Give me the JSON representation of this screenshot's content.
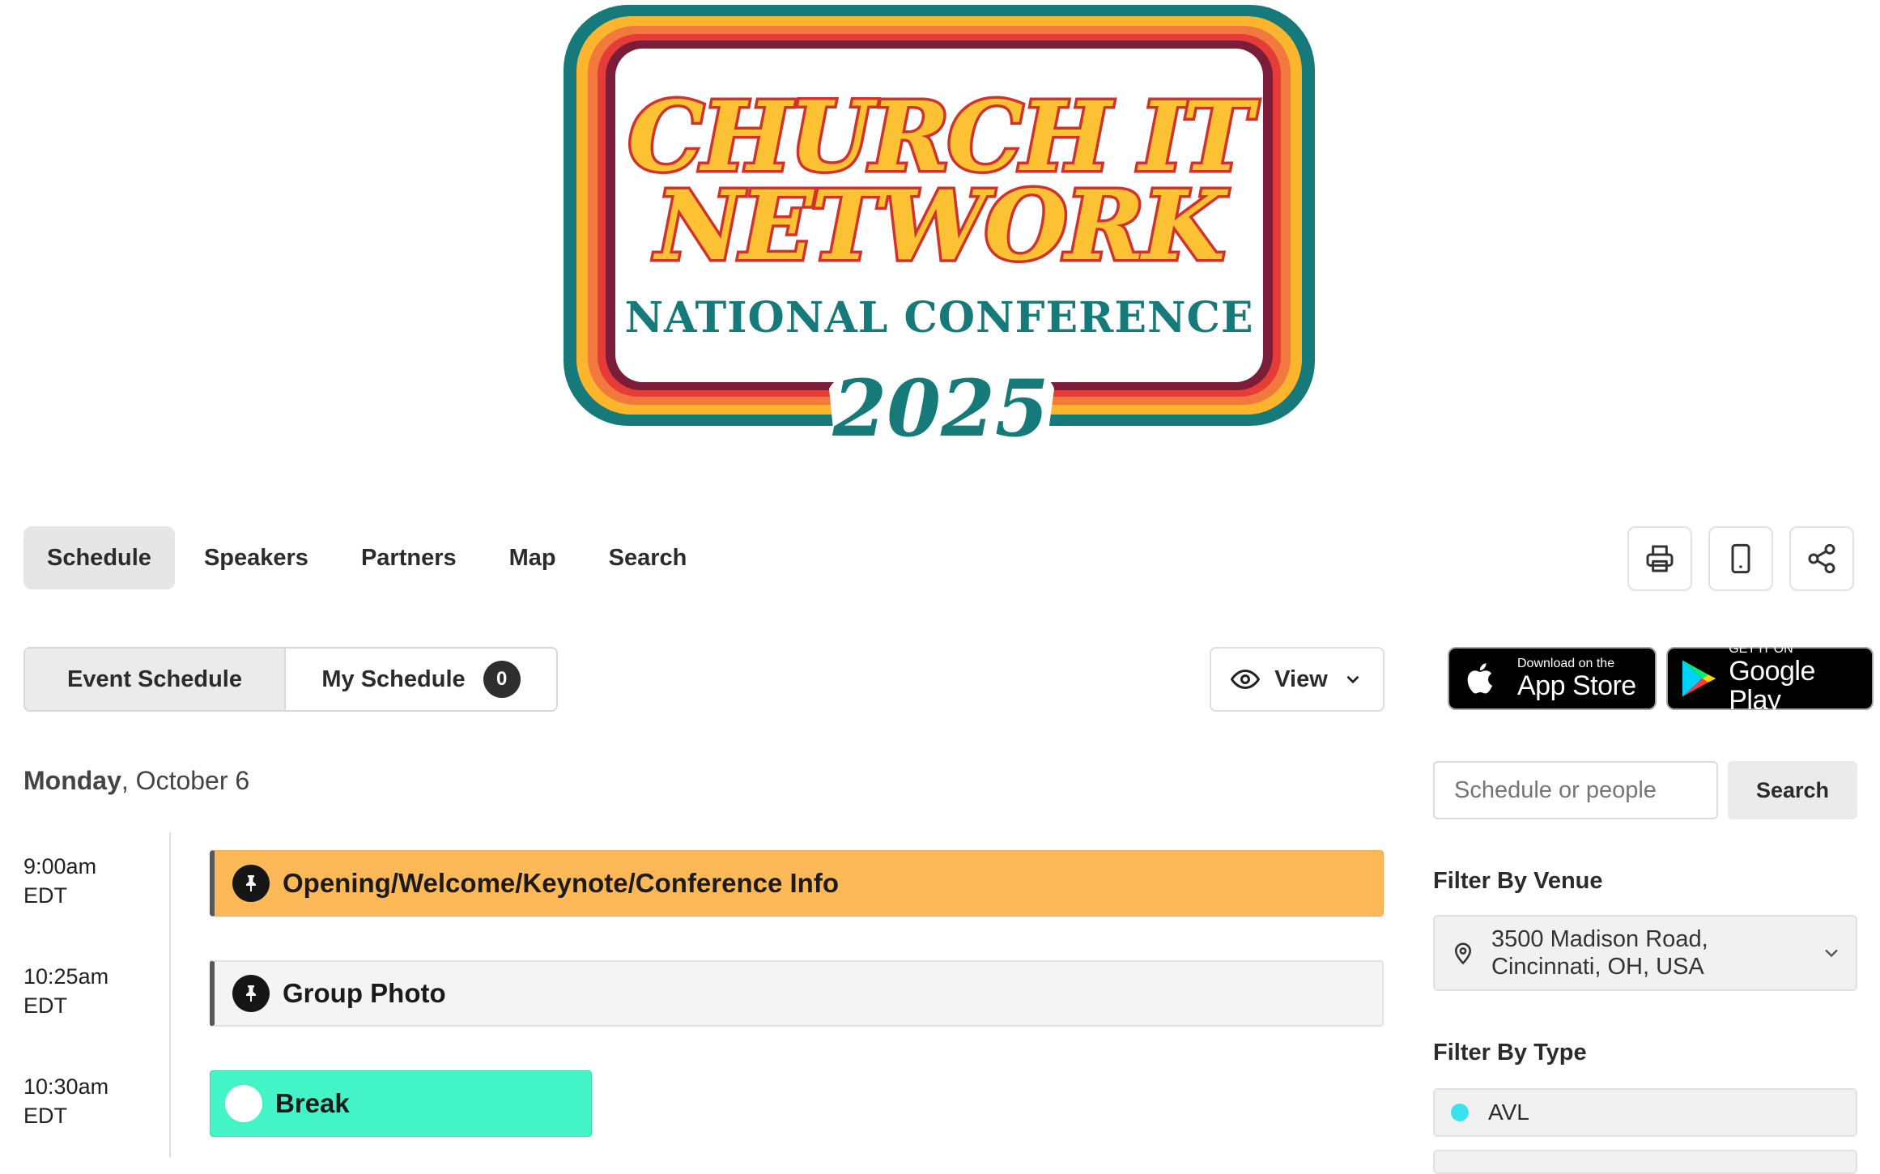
{
  "logo": {
    "line1": "CHURCH IT",
    "line2": "NETWORK",
    "line3": "NATIONAL CONFERENCE",
    "year": "2025"
  },
  "nav": {
    "items": [
      "Schedule",
      "Speakers",
      "Partners",
      "Map",
      "Search"
    ],
    "active": "Schedule"
  },
  "toolbar": {
    "icons": [
      "printer-icon",
      "mobile-icon",
      "share-icon"
    ]
  },
  "schedule_toggle": {
    "event_label": "Event Schedule",
    "my_label": "My Schedule",
    "my_count": "0"
  },
  "view_button": {
    "label": "View"
  },
  "app_store": {
    "small": "Download on the",
    "big": "App Store"
  },
  "google_play": {
    "small": "GET IT ON",
    "big": "Google Play"
  },
  "date": {
    "day": "Monday",
    "rest": ", October 6"
  },
  "times": [
    {
      "time": "9:00am",
      "tz": "EDT"
    },
    {
      "time": "10:25am",
      "tz": "EDT"
    },
    {
      "time": "10:30am",
      "tz": "EDT"
    }
  ],
  "sessions": [
    {
      "title": "Opening/Welcome/Keynote/Conference Info",
      "color": "#fdb957"
    },
    {
      "title": "Group Photo",
      "color": "#f4f4f4"
    },
    {
      "title": "Break",
      "color": "#43f4c6"
    }
  ],
  "sidebar": {
    "search_placeholder": "Schedule or people",
    "search_button": "Search",
    "venue_title": "Filter By Venue",
    "venue_line1": "3500 Madison Road,",
    "venue_line2": "Cincinnati, OH, USA",
    "type_title": "Filter By Type",
    "types": [
      {
        "label": "AVL",
        "color": "#3de0ee"
      }
    ]
  },
  "colors": {
    "teal": "#177a7a",
    "orange": "#f6a623",
    "red": "#d2322d",
    "maroon": "#7b1c38",
    "yellow": "#fdc134"
  }
}
